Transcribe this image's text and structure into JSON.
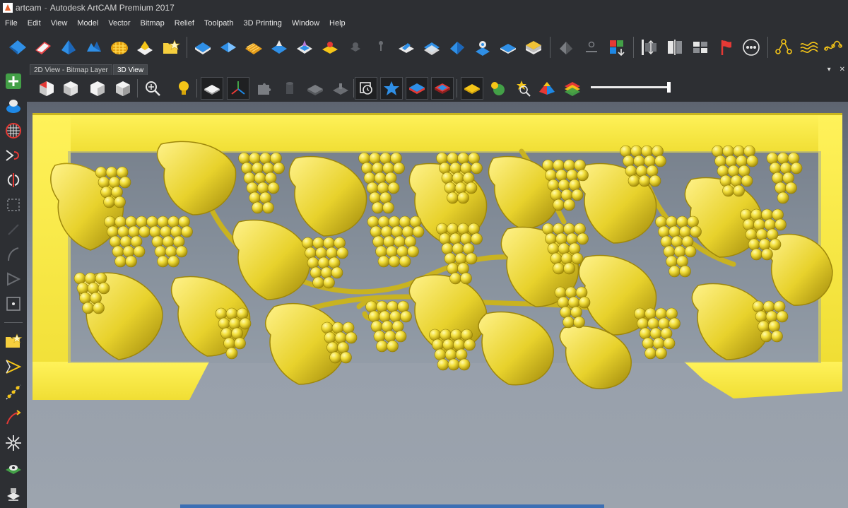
{
  "window": {
    "doc_name": "artcam",
    "separator": "-",
    "app_title": "Autodesk ArtCAM Premium 2017"
  },
  "menu": [
    "File",
    "Edit",
    "View",
    "Model",
    "Vector",
    "Bitmap",
    "Relief",
    "Toolpath",
    "3D Printing",
    "Window",
    "Help"
  ],
  "tabs": {
    "bitmap": "2D View - Bitmap Layer",
    "view3d": "3D View",
    "pin_glyph": "▾",
    "close_glyph": "✕"
  },
  "colors": {
    "relief_yellow": "#f2e64a",
    "relief_shadow": "#b9a815",
    "toolbar_bg": "#2d2f33",
    "accent_blue": "#2f8fe6"
  },
  "main_toolbar_icons": [
    "create-relief-icon",
    "reset-relief-icon",
    "extrude-icon",
    "spin-icon",
    "weave-icon",
    "shape-editor-icon",
    "new-model-icon",
    "relief-layer-icon",
    "blue-shape-icon",
    "texture-icon",
    "merge-relief-icon",
    "offset-relief-icon",
    "sculpt-icon",
    "disabled-icon",
    "pin-icon",
    "interactive-icon",
    "smooth-relief-icon",
    "paste-relief-icon",
    "fade-icon",
    "layer-stack-icon",
    "bake-icon",
    "unpin-icon",
    "color-split-icon",
    "scale-icon",
    "mirror-icon",
    "tile-icon",
    "flag-icon",
    "circle-options-icon",
    "node-icon",
    "wave-icon",
    "wave-nodes-icon"
  ],
  "view_toolbar_icons": [
    "iso-view-icon",
    "front-view-icon",
    "side-view-icon",
    "top-view-icon",
    "zoom-icon",
    "light-icon",
    "shaded-relief-icon",
    "axes-icon",
    "puzzle-icon",
    "cylinder-icon",
    "gray-relief-icon",
    "gray-plane-icon",
    "rotate-view-icon",
    "star-surface-icon",
    "blue-layer-icon",
    "red-layer-icon",
    "yellow-plate-icon",
    "green-blob-icon",
    "search-gear-icon",
    "pyramid-icon",
    "rainbow-layers-icon"
  ],
  "left_toolbar_icons": [
    "add-icon",
    "layer-blob-icon",
    "grid-icon",
    "path-arrow-icon",
    "split-icon",
    "dotted-square-icon",
    "faded-icon",
    "curve-icon",
    "triangle-icon",
    "square-dot-icon",
    "folder-star-icon",
    "vector-icon",
    "node-line-icon",
    "arrow-curve-icon",
    "star-burst-icon",
    "eye-icon",
    "stamp-icon"
  ]
}
